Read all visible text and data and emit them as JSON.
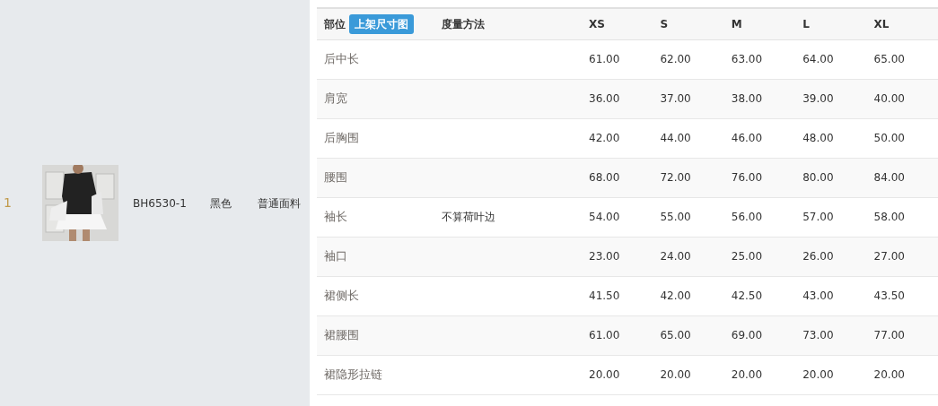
{
  "product": {
    "index": "1",
    "code": "BH6530-1",
    "color_name": "黑色",
    "fabric": "普通面料"
  },
  "size_table": {
    "columns": [
      {
        "label": "部位",
        "button": "上架尺寸图"
      },
      {
        "label": "度量方法"
      },
      {
        "label": "XS"
      },
      {
        "label": "S"
      },
      {
        "label": "M"
      },
      {
        "label": "L"
      },
      {
        "label": "XL"
      }
    ],
    "rows": [
      {
        "part": "后中长",
        "method": "",
        "values": [
          "61.00",
          "62.00",
          "63.00",
          "64.00",
          "65.00"
        ]
      },
      {
        "part": "肩宽",
        "method": "",
        "values": [
          "36.00",
          "37.00",
          "38.00",
          "39.00",
          "40.00"
        ]
      },
      {
        "part": "后胸围",
        "method": "",
        "values": [
          "42.00",
          "44.00",
          "46.00",
          "48.00",
          "50.00"
        ]
      },
      {
        "part": "腰围",
        "method": "",
        "values": [
          "68.00",
          "72.00",
          "76.00",
          "80.00",
          "84.00"
        ]
      },
      {
        "part": "袖长",
        "method": "不算荷叶边",
        "values": [
          "54.00",
          "55.00",
          "56.00",
          "57.00",
          "58.00"
        ]
      },
      {
        "part": "袖口",
        "method": "",
        "values": [
          "23.00",
          "24.00",
          "25.00",
          "26.00",
          "27.00"
        ]
      },
      {
        "part": "裙侧长",
        "method": "",
        "values": [
          "41.50",
          "42.00",
          "42.50",
          "43.00",
          "43.50"
        ]
      },
      {
        "part": "裙腰围",
        "method": "",
        "values": [
          "61.00",
          "65.00",
          "69.00",
          "73.00",
          "77.00"
        ]
      },
      {
        "part": "裙隐形拉链",
        "method": "",
        "values": [
          "20.00",
          "20.00",
          "20.00",
          "20.00",
          "20.00"
        ]
      }
    ]
  }
}
